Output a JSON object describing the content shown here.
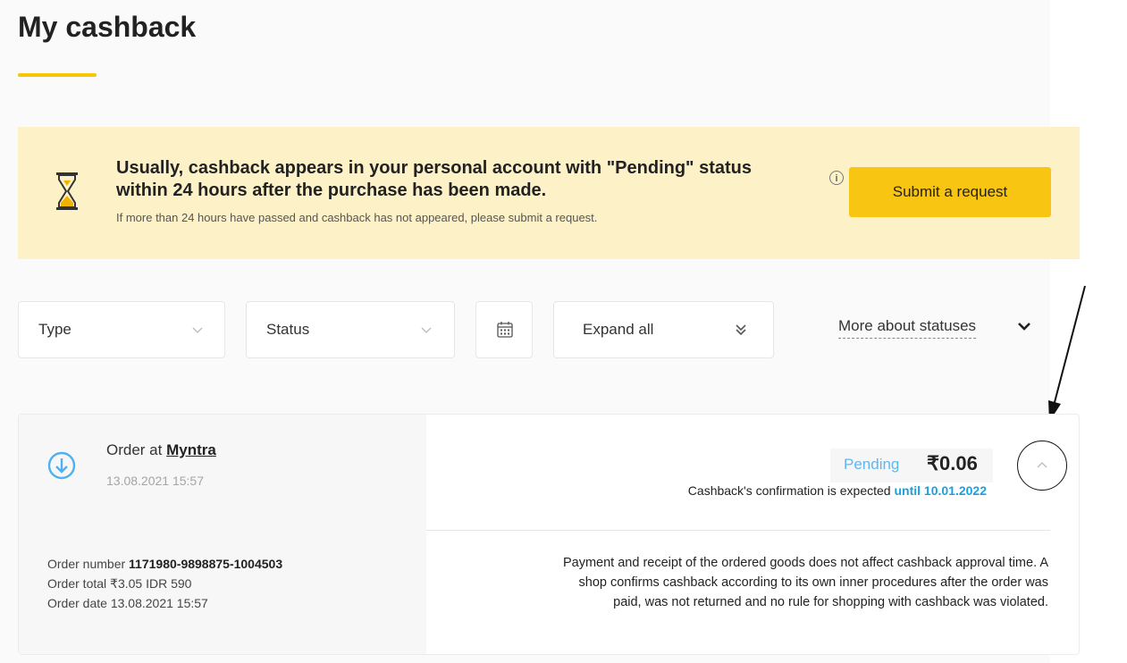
{
  "page": {
    "title": "My cashback"
  },
  "banner": {
    "headline": "Usually, cashback appears in your personal account with \"Pending\" status within 24 hours after the purchase has been made.",
    "subtext": "If more than 24 hours have passed and cashback has not appeared, please submit a request.",
    "info_icon": "i",
    "submit_label": "Submit a request",
    "icons": {
      "status": "hourglass-icon",
      "info": "info-icon"
    }
  },
  "filters": {
    "type_label": "Type",
    "status_label": "Status",
    "expand_label": "Expand all",
    "more_statuses_label": "More about statuses",
    "icons": {
      "date": "calendar-icon",
      "expand": "double-chevron-down-icon",
      "dropdown": "chevron-down-icon"
    }
  },
  "order": {
    "title_prefix": "Order at",
    "shop": "Myntra",
    "datetime": "13.08.2021 15:57",
    "number_label": "Order number",
    "number": "1171980-9898875-1004503",
    "total_label": "Order total",
    "total": "₹3.05 IDR 590",
    "date_label": "Order date",
    "date": "13.08.2021 15:57",
    "status": "Pending",
    "amount": "₹0.06",
    "confirmation_prefix": "Cashback's confirmation is expected",
    "confirmation_date": "until 10.01.2022",
    "note": "Payment and receipt of the ordered goods does not affect cashback approval time. A shop confirms cashback according to its own inner procedures after the order was paid, was not returned and no rule for shopping with cashback was violated.",
    "icons": {
      "type": "arrow-down-circle-icon",
      "collapse": "chevron-up-icon"
    }
  },
  "colors": {
    "accent_yellow": "#f9c513",
    "banner_bg": "#fdf1c7",
    "pending_blue": "#5fb7ef",
    "link_blue": "#1a9fe0"
  }
}
